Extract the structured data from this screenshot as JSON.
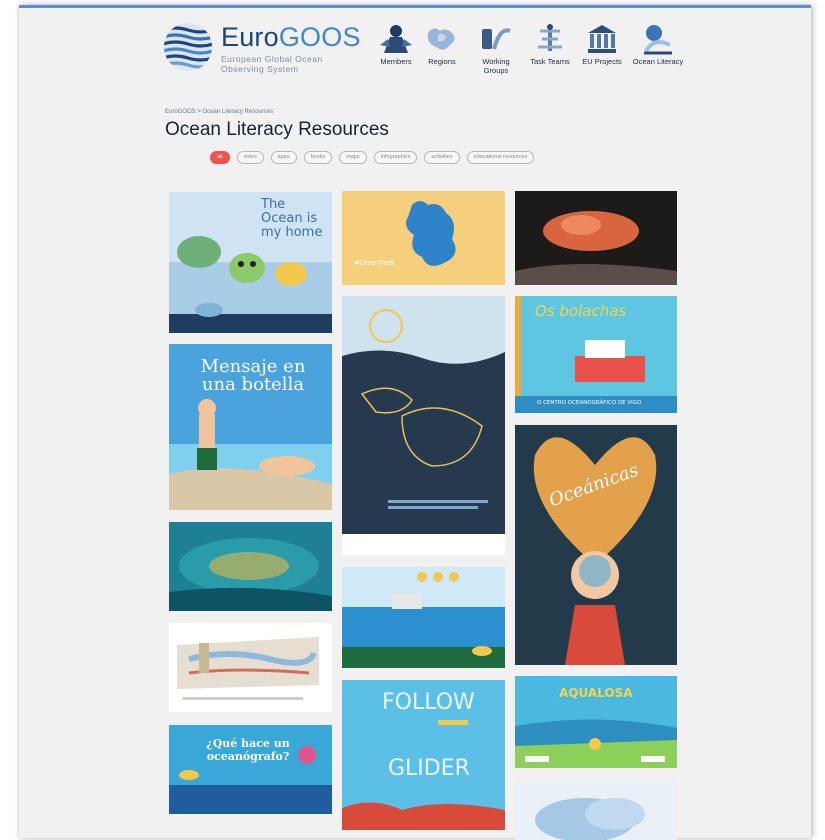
{
  "logo": {
    "word_dark": "Euro",
    "word_light": "GOOS",
    "subtitle": "European Global Ocean Observing System"
  },
  "nav": {
    "items": [
      {
        "label": "Members",
        "icon": "members-icon"
      },
      {
        "label": "Regions",
        "icon": "regions-icon"
      },
      {
        "label": "Working Groups",
        "icon": "working-groups-icon"
      },
      {
        "label": "Task Teams",
        "icon": "task-teams-icon"
      },
      {
        "label": "EU Projects",
        "icon": "eu-projects-icon"
      },
      {
        "label": "Ocean Literacy",
        "icon": "ocean-literacy-icon"
      }
    ]
  },
  "breadcrumb": "EuroGOOS > Ocean Literacy Resources",
  "page_title": "Ocean Literacy Resources",
  "filters": [
    {
      "label": "all",
      "active": true
    },
    {
      "label": "video"
    },
    {
      "label": "apps"
    },
    {
      "label": "books"
    },
    {
      "label": "maps"
    },
    {
      "label": "infographics"
    },
    {
      "label": "activities"
    },
    {
      "label": "educational resources"
    }
  ],
  "cards": {
    "c1_text": "The Ocean is my home",
    "c2_text": "#DropTheB",
    "c4_text": "Mensaje en una botella",
    "c6_text": "Os bolachas",
    "c6_footer": "O CENTRO OCEANOGRÁFICO DE VIGO",
    "c8_text": "Oceánicas",
    "c11_text_1": "FOLLOW",
    "c11_text_2": "GLIDER",
    "c12_text": "AQUALOSA",
    "c13_text": "¿Qué hace un oceanógrafo?"
  },
  "colors": {
    "accent": "#f05252",
    "brand_dark": "#20457e",
    "brand_light": "#3f87d0",
    "header_bar": "#5b8fd0"
  }
}
